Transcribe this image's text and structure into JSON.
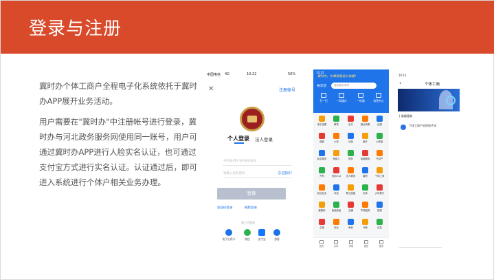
{
  "header": {
    "title": "登录与注册"
  },
  "body": {
    "para1": "冀时办个体工商户全程电子化系统依托于冀时办APP展开业务活动。",
    "para2": "用户需要在\"冀时办\"中注册帐号进行登录，冀时办与河北政务服务网使用同一账号，用户可通过冀时办APP进行人脸实名认证，也可通过支付宝方式进行实名认证。认证通过后，即可进入系统进行个体户相关业务办理。"
  },
  "phone1": {
    "carrier": "中国电信",
    "network": "4G",
    "time": "10:22",
    "battery": "50%",
    "close_icon": "close-icon",
    "register_link": "注册帐号",
    "tab_personal": "个人登录",
    "tab_legal": "法人登录",
    "username_placeholder": "手机号/用户名/身份证号",
    "password_placeholder": "请输入您的密码",
    "forgot_link": "忘记密码?",
    "login_button": "登录",
    "sms_login": "验证码登录",
    "face_login": "刷脸登录",
    "other_methods": "第三方登录",
    "social": [
      {
        "label": "电子社保卡",
        "icon": "social-security-icon",
        "color": "#1a73e8"
      },
      {
        "label": "微信",
        "icon": "wechat-icon",
        "color": "#2bb24c"
      },
      {
        "label": "支付宝",
        "icon": "alipay-icon",
        "color": "#1677ff"
      },
      {
        "label": "游客",
        "icon": "guest-icon",
        "color": "#1a73e8"
      }
    ]
  },
  "phone2": {
    "status": "10:22",
    "banner": "冀时办，办事就是这么快捷！",
    "region": "裕华区",
    "search_placeholder": "搜索服务/事项",
    "quick_actions": [
      {
        "label": "扫一扫"
      },
      {
        "label": "一网通办"
      },
      {
        "label": "一码通"
      },
      {
        "label": "消息中心"
      }
    ],
    "grid": [
      "电子证照",
      "教育",
      "出行",
      "营业执照",
      "应缴",
      "缴费",
      "公安",
      "社保",
      "医疗",
      "公积金",
      "民生服务",
      "残疾人",
      "税务",
      "金融服务",
      "不动产",
      "开车",
      "流动人口",
      "法人服务",
      "婚育",
      "个体工商",
      "就业创业",
      "司法",
      "职业技能",
      "文体",
      "乡村振兴",
      "健康码",
      "食品药品",
      "交通",
      "市场监督",
      "旅游",
      "文旅",
      "农业",
      "养老",
      "气象",
      "应急"
    ],
    "nav": [
      "首页",
      "办事",
      "事项",
      "我的",
      "更多"
    ]
  },
  "phone3": {
    "status": "10:12",
    "title": "个体工商",
    "section": "| 省级服务",
    "item_label": "个体工商户全程电子化"
  }
}
